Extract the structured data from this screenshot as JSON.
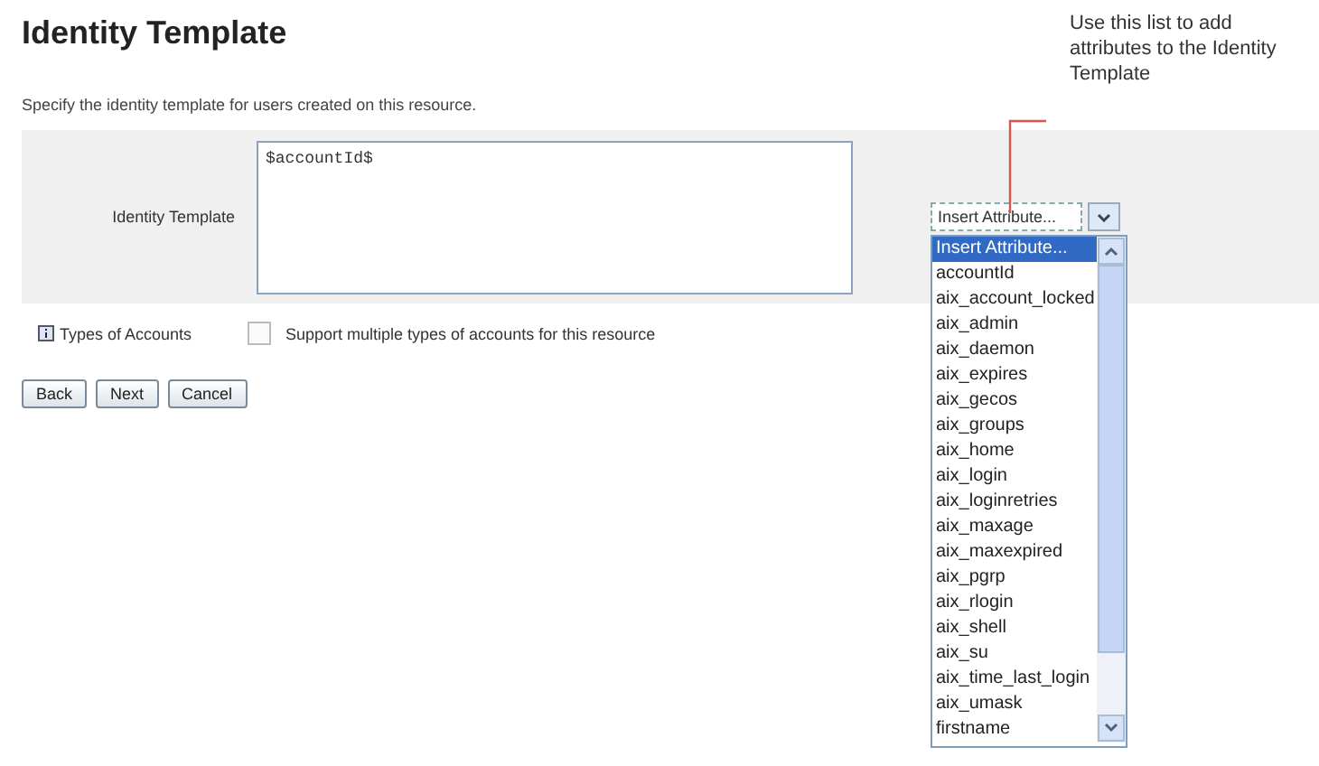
{
  "title": "Identity Template",
  "description": "Specify the identity template for users created on this resource.",
  "identity_template": {
    "label": "Identity Template",
    "value": "$accountId$"
  },
  "attribute_select": {
    "value": "Insert Attribute...",
    "options": [
      {
        "label": "Insert Attribute...",
        "selected": true
      },
      {
        "label": "accountId",
        "selected": false
      },
      {
        "label": "aix_account_locked",
        "selected": false
      },
      {
        "label": "aix_admin",
        "selected": false
      },
      {
        "label": "aix_daemon",
        "selected": false
      },
      {
        "label": "aix_expires",
        "selected": false
      },
      {
        "label": "aix_gecos",
        "selected": false
      },
      {
        "label": "aix_groups",
        "selected": false
      },
      {
        "label": "aix_home",
        "selected": false
      },
      {
        "label": "aix_login",
        "selected": false
      },
      {
        "label": "aix_loginretries",
        "selected": false
      },
      {
        "label": "aix_maxage",
        "selected": false
      },
      {
        "label": "aix_maxexpired",
        "selected": false
      },
      {
        "label": "aix_pgrp",
        "selected": false
      },
      {
        "label": "aix_rlogin",
        "selected": false
      },
      {
        "label": "aix_shell",
        "selected": false
      },
      {
        "label": "aix_su",
        "selected": false
      },
      {
        "label": "aix_time_last_login",
        "selected": false
      },
      {
        "label": "aix_umask",
        "selected": false
      },
      {
        "label": "firstname",
        "selected": false
      }
    ]
  },
  "callout": "Use this list to add attributes to the Identity Template",
  "types_of_accounts": {
    "label": "Types of Accounts",
    "checkbox_label": "Support multiple types of accounts for this resource",
    "checked": false
  },
  "buttons": [
    "Back",
    "Next",
    "Cancel"
  ]
}
